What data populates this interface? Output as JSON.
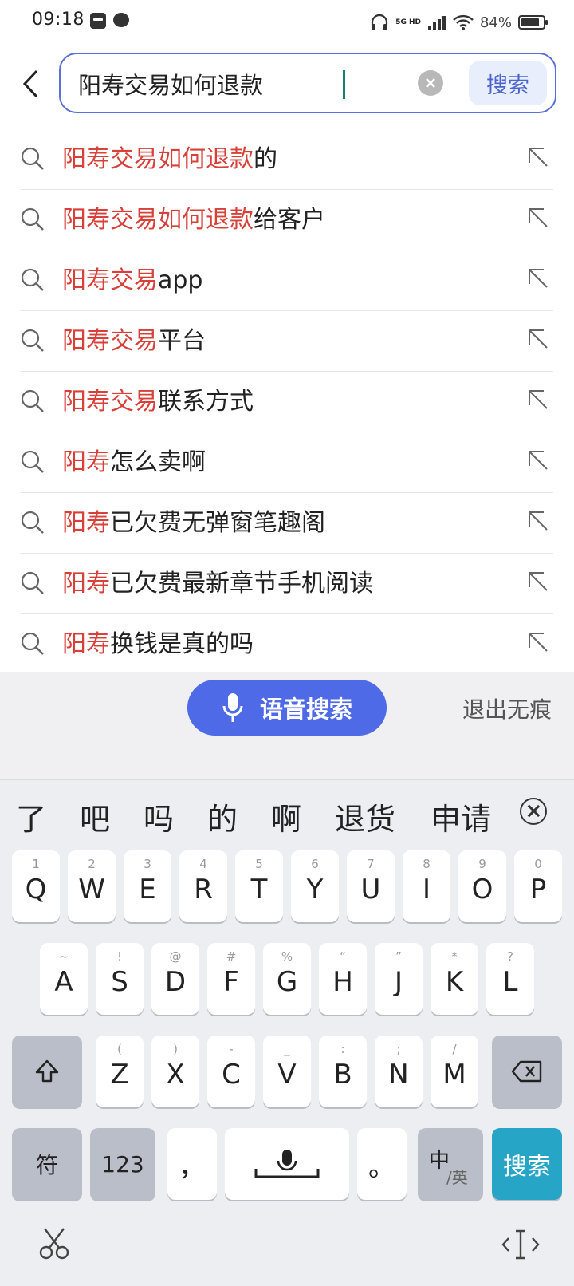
{
  "status_bar": {
    "time": "09:18",
    "network": "5G HD",
    "battery_percent": "84%"
  },
  "search": {
    "query": "阳寿交易如何退款",
    "submit_label": "搜索"
  },
  "suggestions": [
    {
      "highlight": "阳寿交易如何退款",
      "rest": "的"
    },
    {
      "highlight": "阳寿交易如何退款",
      "rest": "给客户"
    },
    {
      "highlight": "阳寿交易",
      "rest": "app"
    },
    {
      "highlight": "阳寿交易",
      "rest": "平台"
    },
    {
      "highlight": "阳寿交易",
      "rest": "联系方式"
    },
    {
      "highlight": "阳寿",
      "rest": "怎么卖啊"
    },
    {
      "highlight": "阳寿",
      "rest": "已欠费无弹窗笔趣阁"
    },
    {
      "highlight": "阳寿",
      "rest": "已欠费最新章节手机阅读"
    },
    {
      "highlight": "阳寿",
      "rest": "换钱是真的吗"
    }
  ],
  "voice": {
    "label": "语音搜索",
    "exit_label": "退出无痕"
  },
  "keyboard": {
    "candidates": [
      "了",
      "吧",
      "吗",
      "的",
      "啊",
      "退货",
      "申请"
    ],
    "row1": [
      {
        "key": "Q",
        "hint": "1"
      },
      {
        "key": "W",
        "hint": "2"
      },
      {
        "key": "E",
        "hint": "3"
      },
      {
        "key": "R",
        "hint": "4"
      },
      {
        "key": "T",
        "hint": "5"
      },
      {
        "key": "Y",
        "hint": "6"
      },
      {
        "key": "U",
        "hint": "7"
      },
      {
        "key": "I",
        "hint": "8"
      },
      {
        "key": "O",
        "hint": "9"
      },
      {
        "key": "P",
        "hint": "0"
      }
    ],
    "row2": [
      {
        "key": "A",
        "hint": "~"
      },
      {
        "key": "S",
        "hint": "!"
      },
      {
        "key": "D",
        "hint": "@"
      },
      {
        "key": "F",
        "hint": "#"
      },
      {
        "key": "G",
        "hint": "%"
      },
      {
        "key": "H",
        "hint": "“"
      },
      {
        "key": "J",
        "hint": "”"
      },
      {
        "key": "K",
        "hint": "*"
      },
      {
        "key": "L",
        "hint": "?"
      }
    ],
    "row3": [
      {
        "key": "Z",
        "hint": "("
      },
      {
        "key": "X",
        "hint": ")"
      },
      {
        "key": "C",
        "hint": "-"
      },
      {
        "key": "V",
        "hint": "_"
      },
      {
        "key": "B",
        "hint": ":"
      },
      {
        "key": "N",
        "hint": ";"
      },
      {
        "key": "M",
        "hint": "/"
      }
    ],
    "symbol_key": "符",
    "number_key": "123",
    "comma_key": "，",
    "period_key": "。",
    "lang_key_main": "中",
    "lang_key_sub": "/英",
    "search_key": "搜索"
  },
  "colors": {
    "accent": "#4e6ae6",
    "highlight": "#d8403a",
    "search_key": "#26a5c6"
  }
}
